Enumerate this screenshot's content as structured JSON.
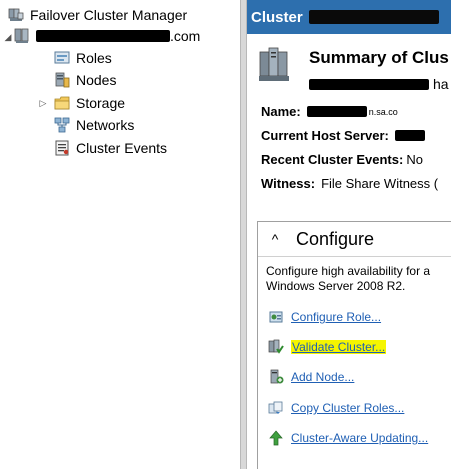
{
  "tree": {
    "root_label": "Failover Cluster Manager",
    "cluster_suffix": ".com",
    "items": [
      {
        "label": "Roles"
      },
      {
        "label": "Nodes"
      },
      {
        "label": "Storage"
      },
      {
        "label": "Networks"
      },
      {
        "label": "Cluster Events"
      }
    ]
  },
  "header": {
    "title": "Cluster"
  },
  "summary": {
    "title": "Summary of Clus",
    "sub_suffix": "ha",
    "name_label": "Name:",
    "name_suffix": "n.sa.co",
    "host_label": "Current Host Server:",
    "events_label": "Recent Cluster Events:",
    "events_value": "No",
    "witness_label": "Witness:",
    "witness_value": "File Share Witness ("
  },
  "configure": {
    "heading": "Configure",
    "desc_line1": "Configure high availability for a",
    "desc_line2": "Windows Server 2008 R2.",
    "actions": [
      {
        "label": "Configure Role..."
      },
      {
        "label": "Validate Cluster..."
      },
      {
        "label": "Add Node..."
      },
      {
        "label": "Copy Cluster Roles..."
      },
      {
        "label": "Cluster-Aware Updating..."
      }
    ]
  },
  "colors": {
    "header_bg": "#2d6fae",
    "link": "#1f5fb4",
    "highlight": "#f5f500"
  }
}
